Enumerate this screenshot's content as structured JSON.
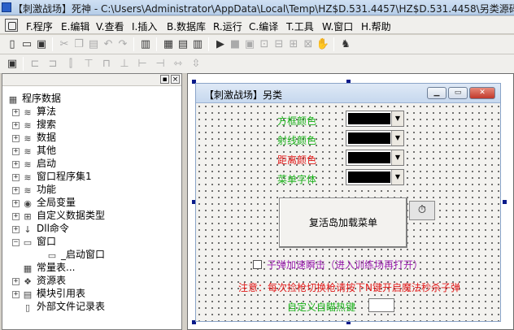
{
  "window": {
    "title": "【刺激战场】死神 - C:\\Users\\Administrator\\AppData\\Local\\Temp\\HZ$D.531.4457\\HZ$D.531.4458\\另类源码"
  },
  "menu": {
    "items": [
      "F.程序",
      "E.编辑",
      "V.查看",
      "I.插入",
      "B.数据库",
      "R.运行",
      "C.编译",
      "T.工具",
      "W.窗口",
      "H.帮助"
    ]
  },
  "toolbar1": {
    "icons": [
      "new-file-icon",
      "open-folder-icon",
      "save-icon",
      "cut-icon",
      "copy-icon",
      "paste-icon",
      "undo-icon",
      "redo-icon",
      "find-icon",
      "layout1-icon",
      "layout2-icon",
      "layout3-icon",
      "run-icon",
      "stop-icon",
      "debug1-icon",
      "debug2-icon",
      "debug3-icon",
      "debug4-icon",
      "debug5-icon",
      "hand-icon",
      "support-icon"
    ]
  },
  "toolbar2": {
    "icons": [
      "align-icon",
      "align-left-icon",
      "align-center-icon",
      "align-right-icon",
      "align-top-icon",
      "align-middle-icon",
      "align-bottom-icon",
      "same-width-icon",
      "same-height-icon",
      "hspace-icon",
      "vspace-icon"
    ]
  },
  "panel": {
    "minimize": "▪",
    "close": "×"
  },
  "tree": {
    "root": "程序数据",
    "items": [
      {
        "label": "算法",
        "icon": "layers-icon",
        "expander": "+"
      },
      {
        "label": "搜索",
        "icon": "layers-icon",
        "expander": "+"
      },
      {
        "label": "数据",
        "icon": "layers-icon",
        "expander": "+"
      },
      {
        "label": "其他",
        "icon": "layers-icon",
        "expander": "+"
      },
      {
        "label": "启动",
        "icon": "layers-icon",
        "expander": "+"
      },
      {
        "label": "窗口程序集1",
        "icon": "layers-icon",
        "expander": "+"
      },
      {
        "label": "功能",
        "icon": "layers-icon",
        "expander": "+"
      },
      {
        "label": "全局变量",
        "icon": "global-var-icon",
        "expander": "+"
      },
      {
        "label": "自定义数据类型",
        "icon": "datatype-icon",
        "expander": "+"
      },
      {
        "label": "Dll命令",
        "icon": "dll-icon",
        "expander": "+"
      },
      {
        "label": "窗口",
        "icon": "window-icon",
        "expander": "−"
      },
      {
        "label": "_启动窗口",
        "icon": "window-icon",
        "expander": ""
      },
      {
        "label": "常量表...",
        "icon": "constants-icon",
        "expander": ""
      },
      {
        "label": "资源表",
        "icon": "resources-icon",
        "expander": "+"
      },
      {
        "label": "模块引用表",
        "icon": "module-icon",
        "expander": "+"
      },
      {
        "label": "外部文件记录表",
        "icon": "file-record-icon",
        "expander": ""
      }
    ]
  },
  "form": {
    "title": "【刺激战场】另类",
    "labels": {
      "box_color": "方框颜色",
      "ray_color": "射线颜色",
      "distance_color": "距离颜色",
      "menu_font": "菜单字体"
    },
    "combo_color": "#000000",
    "main_button": "复活岛加载菜单",
    "timer_icon": "⏱",
    "checkbox_label": "子弹加速瞬击（进入训练场再打开）",
    "checkbox_checked": false,
    "notice": "注意：每次捡枪切换枪请按下N键开启魔法秒杀子弹",
    "hotkey_label": "自定义自瞄热键",
    "hotkey_value": ""
  },
  "colors": {
    "green_label": "#18b018",
    "purple_label": "#9b1fb0",
    "red_notice": "#e01818"
  }
}
